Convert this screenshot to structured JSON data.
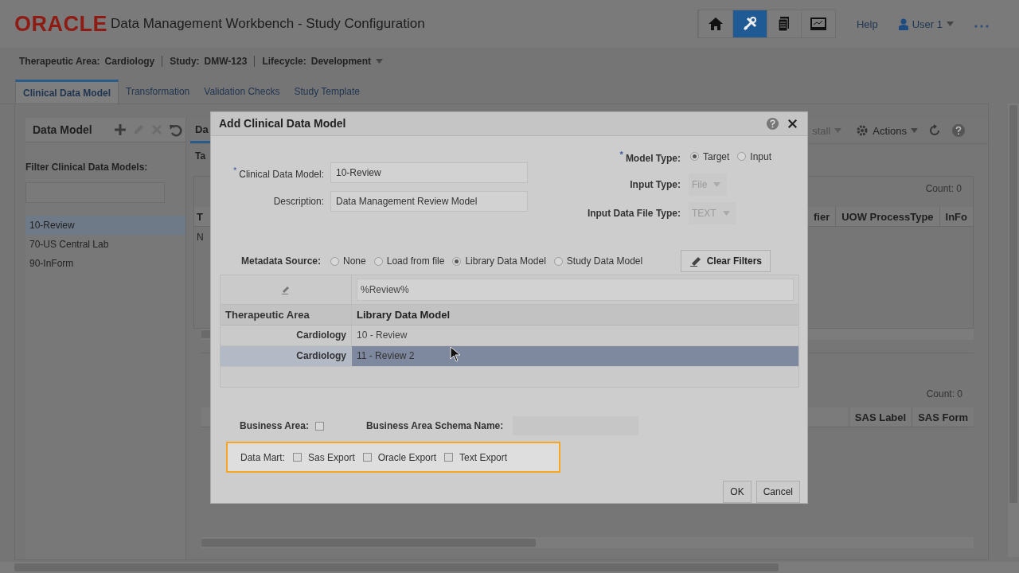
{
  "header": {
    "logo": "ORACLE",
    "title": "Data Management Workbench - Study Configuration",
    "nav_icons": [
      {
        "kind": "home",
        "selected": false
      },
      {
        "kind": "tools",
        "selected": true
      },
      {
        "kind": "documents",
        "selected": false
      },
      {
        "kind": "monitor",
        "selected": false
      }
    ],
    "help": "Help",
    "user": "User 1"
  },
  "context": [
    {
      "label": "Therapeutic Area:",
      "value": "Cardiology",
      "dropdown": false
    },
    {
      "label": "Study:",
      "value": "DMW-123",
      "dropdown": false
    },
    {
      "label": "Lifecycle:",
      "value": "Development",
      "dropdown": true
    }
  ],
  "tabs": [
    {
      "label": "Clinical Data Model",
      "selected": true
    },
    {
      "label": "Transformation",
      "selected": false
    },
    {
      "label": "Validation Checks",
      "selected": false
    },
    {
      "label": "Study Template",
      "selected": false
    }
  ],
  "data_model_panel": {
    "title": "Data Model",
    "tools": [
      {
        "kind": "add",
        "disabled": false
      },
      {
        "kind": "edit",
        "disabled": true
      },
      {
        "kind": "delete",
        "disabled": true
      },
      {
        "kind": "undo",
        "disabled": false
      }
    ],
    "filter_label": "Filter Clinical Data Models:",
    "items": [
      {
        "label": "10-Review",
        "selected": true
      },
      {
        "label": "70-US Central Lab",
        "selected": false
      },
      {
        "label": "90-InForm",
        "selected": false
      }
    ]
  },
  "detail_panel": {
    "tab": "Da",
    "row_label": "Ta",
    "toolbar": [
      {
        "kind": "menu",
        "label": "stall",
        "disabled": true
      },
      {
        "kind": "actions",
        "label": "Actions",
        "disabled": false
      }
    ],
    "upper_table": {
      "count": "Count: 0",
      "columns_left": [
        "T"
      ],
      "columns_right": [
        "fier",
        "UOW ProcessType",
        "InFo"
      ],
      "row_fragment": "N"
    },
    "lower_table": {
      "count": "Count: 0",
      "columns_right": [
        "SAS Label",
        "SAS Form"
      ]
    }
  },
  "dialog": {
    "title": "Add Clinical Data Model",
    "fields": [
      {
        "label": "Clinical Data Model:",
        "marker": "*",
        "value": "10-Review"
      },
      {
        "label": "Description:",
        "value": "Data Management Review Model"
      }
    ],
    "model_type": {
      "label": "Model Type:",
      "marker": "*",
      "options": [
        {
          "label": "Target",
          "selected": true
        },
        {
          "label": "Input",
          "selected": false
        }
      ]
    },
    "selects": [
      {
        "label": "Input Type:",
        "value": "File",
        "disabled": true
      },
      {
        "label": "Input Data File Type:",
        "value": "TEXT",
        "disabled": true
      }
    ],
    "metadata_source": {
      "label": "Metadata Source:",
      "options": [
        {
          "label": "None",
          "selected": false
        },
        {
          "label": "Load from file",
          "selected": false
        },
        {
          "label": "Library Data Model",
          "selected": true
        },
        {
          "label": "Study Data Model",
          "selected": false
        }
      ]
    },
    "clear_filters": "Clear Filters",
    "table": {
      "filter": "%Review%",
      "columns": [
        "Therapeutic Area",
        "Library Data Model"
      ],
      "rows": [
        {
          "area": "Cardiology",
          "model": "10 - Review",
          "selected": false
        },
        {
          "area": "Cardiology",
          "model": "11 - Review 2",
          "selected": true
        }
      ]
    },
    "business_area": {
      "label": "Business Area:",
      "checked": false
    },
    "schema_name": {
      "label": "Business Area Schema Name:"
    },
    "data_mart": {
      "label": "Data Mart:",
      "highlighted": true,
      "options": [
        {
          "label": "Sas Export",
          "checked": false
        },
        {
          "label": "Oracle Export",
          "checked": false
        },
        {
          "label": "Text Export",
          "checked": false
        }
      ]
    },
    "buttons": [
      "OK",
      "Cancel"
    ]
  }
}
